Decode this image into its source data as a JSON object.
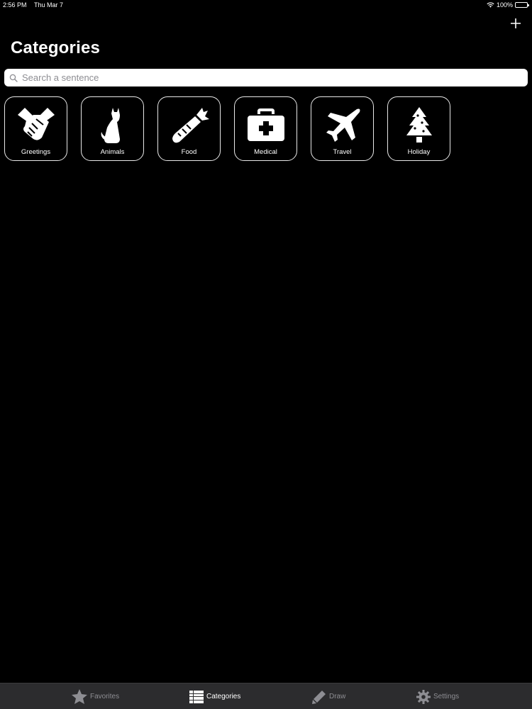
{
  "status": {
    "time": "2:56 PM",
    "date": "Thu Mar 7",
    "battery": "100%"
  },
  "header": {
    "title": "Categories",
    "add_icon": "plus-icon"
  },
  "search": {
    "placeholder": "Search a sentence",
    "value": ""
  },
  "categories": [
    {
      "label": "Greetings",
      "icon": "handshake-icon"
    },
    {
      "label": "Animals",
      "icon": "cat-icon"
    },
    {
      "label": "Food",
      "icon": "carrot-icon"
    },
    {
      "label": "Medical",
      "icon": "medical-kit-icon"
    },
    {
      "label": "Travel",
      "icon": "airplane-icon"
    },
    {
      "label": "Holiday",
      "icon": "christmas-tree-icon"
    }
  ],
  "tabs": [
    {
      "label": "Favorites",
      "icon": "star-icon",
      "active": false
    },
    {
      "label": "Categories",
      "icon": "list-icon",
      "active": true
    },
    {
      "label": "Draw",
      "icon": "pencil-icon",
      "active": false
    },
    {
      "label": "Settings",
      "icon": "gear-icon",
      "active": false
    }
  ],
  "colors": {
    "background": "#000000",
    "tab_bar": "#2c2c2e",
    "tab_inactive": "#8e8e93",
    "tab_active": "#ffffff",
    "tile_border": "#e8e8e8"
  }
}
